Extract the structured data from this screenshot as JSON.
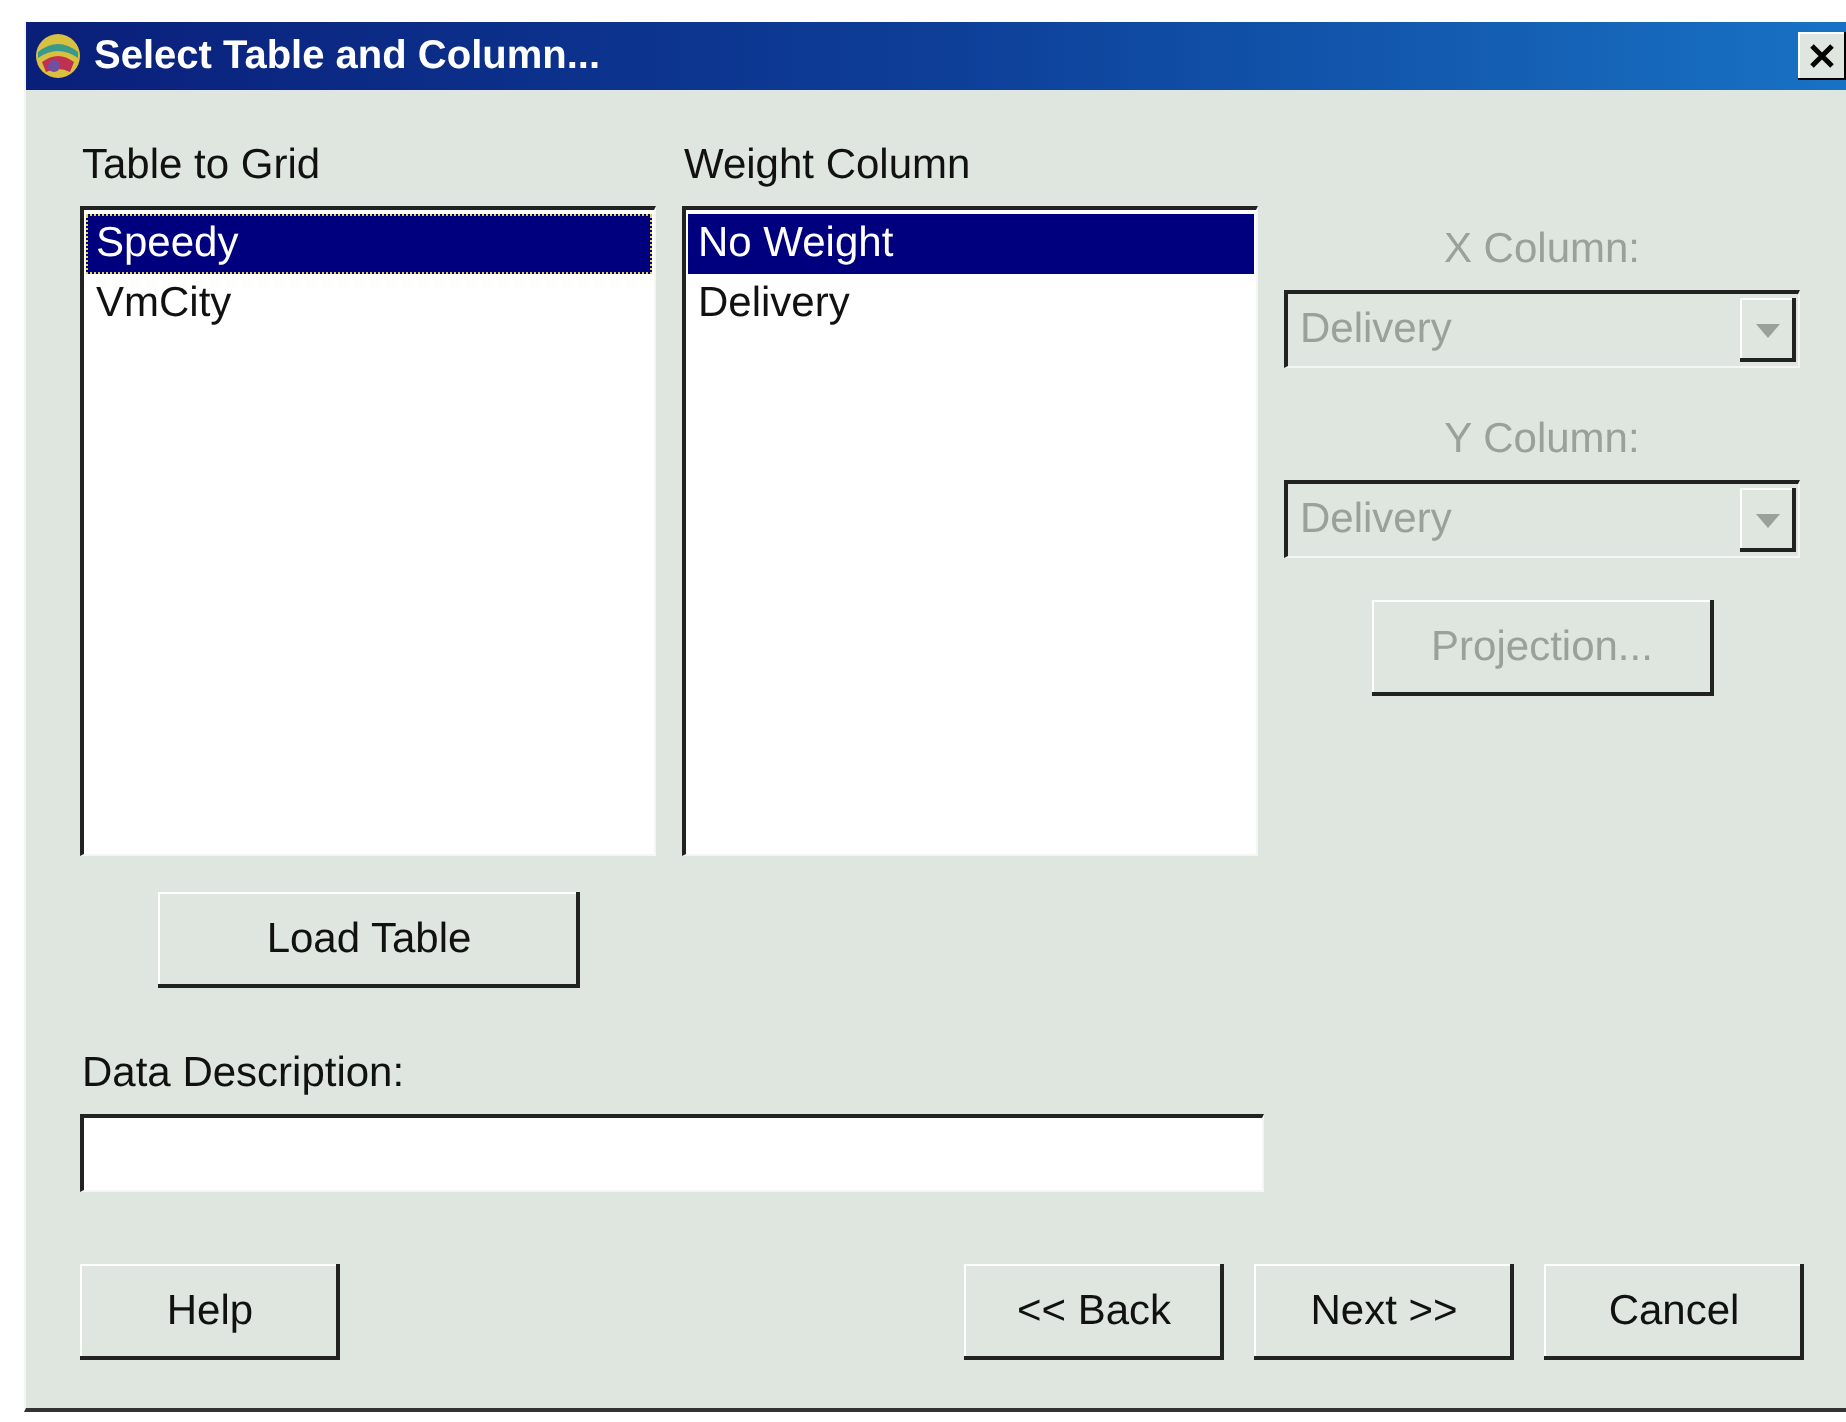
{
  "window": {
    "title": "Select Table and Column..."
  },
  "table_list": {
    "label": "Table to Grid",
    "items": [
      {
        "text": "Speedy",
        "selected": true,
        "focused": true
      },
      {
        "text": "VmCity",
        "selected": false,
        "focused": false
      }
    ]
  },
  "weight_list": {
    "label": "Weight Column",
    "items": [
      {
        "text": "No Weight",
        "selected": true,
        "focused": false
      },
      {
        "text": "Delivery",
        "selected": false,
        "focused": false
      }
    ]
  },
  "x_column": {
    "label": "X Column:",
    "value": "Delivery",
    "disabled": true
  },
  "y_column": {
    "label": "Y Column:",
    "value": "Delivery",
    "disabled": true
  },
  "projection_button": {
    "label": "Projection...",
    "disabled": true
  },
  "load_button": {
    "label": "Load Table"
  },
  "description": {
    "label": "Data Description:"
  },
  "buttons": [
    {
      "label": "Help"
    },
    {
      "label": "<< Back"
    },
    {
      "label": "Next >>"
    },
    {
      "label": "Cancel"
    }
  ]
}
